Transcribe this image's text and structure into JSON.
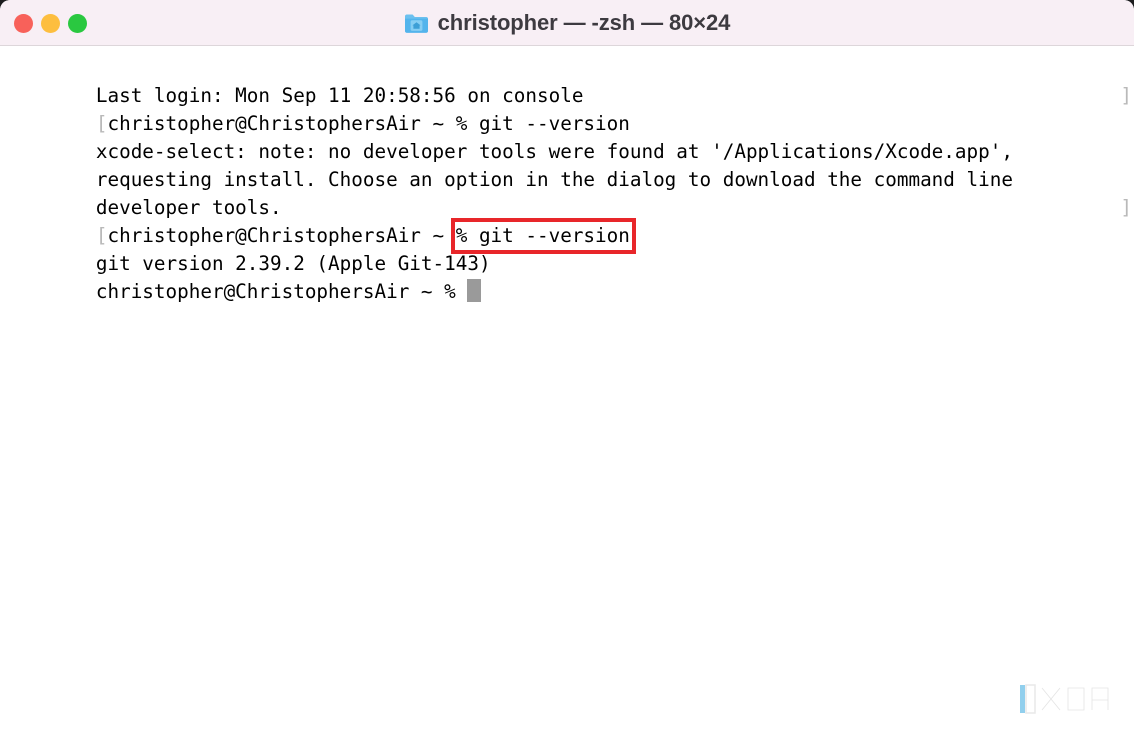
{
  "window": {
    "title": "christopher — -zsh — 80×24",
    "icon": "home-folder-icon",
    "titlebar_color": "#f8eff5",
    "background_color": "#ffffff"
  },
  "traffic_lights": [
    {
      "name": "close",
      "label": "Close",
      "color": "#f8615a"
    },
    {
      "name": "minimize",
      "label": "Minimize",
      "color": "#fdbe3f"
    },
    {
      "name": "maximize",
      "label": "Maximize",
      "color": "#2ac840"
    }
  ],
  "terminal": {
    "columns": "80",
    "rows": "24",
    "shell": "-zsh",
    "text_color": "#000000",
    "cursor_color": "#9a9a9a",
    "lines": [
      {
        "id": "last-login",
        "left_bracket": "",
        "right_bracket": "",
        "text": "Last login: Mon Sep 11 20:58:56 on console"
      },
      {
        "id": "prompt-1",
        "left_bracket": "[",
        "right_bracket": "]",
        "text": "christopher@ChristophersAir ~ % git --version"
      },
      {
        "id": "xcode-note-1",
        "left_bracket": "",
        "right_bracket": "",
        "text": "xcode-select: note: no developer tools were found at '/Applications/Xcode.app',"
      },
      {
        "id": "xcode-note-2",
        "left_bracket": "",
        "right_bracket": "",
        "text": "requesting install. Choose an option in the dialog to download the command line"
      },
      {
        "id": "xcode-note-3",
        "left_bracket": "",
        "right_bracket": "",
        "text": "developer tools."
      },
      {
        "id": "git-version-output",
        "left_bracket": "",
        "right_bracket": "",
        "text": "git version 2.39.2 (Apple Git-143)"
      }
    ],
    "highlighted_prompt": {
      "left_bracket": "[",
      "right_bracket": "]",
      "prefix": "christopher@ChristophersAir ~ ",
      "command": "% git --version",
      "highlight_color": "#e8262a"
    },
    "final_prompt": {
      "text": "christopher@ChristophersAir ~ % ",
      "cursor": "block"
    }
  },
  "watermark": {
    "name": "xda-logo",
    "text": "XDA",
    "accent_color": "#39a9e0"
  }
}
